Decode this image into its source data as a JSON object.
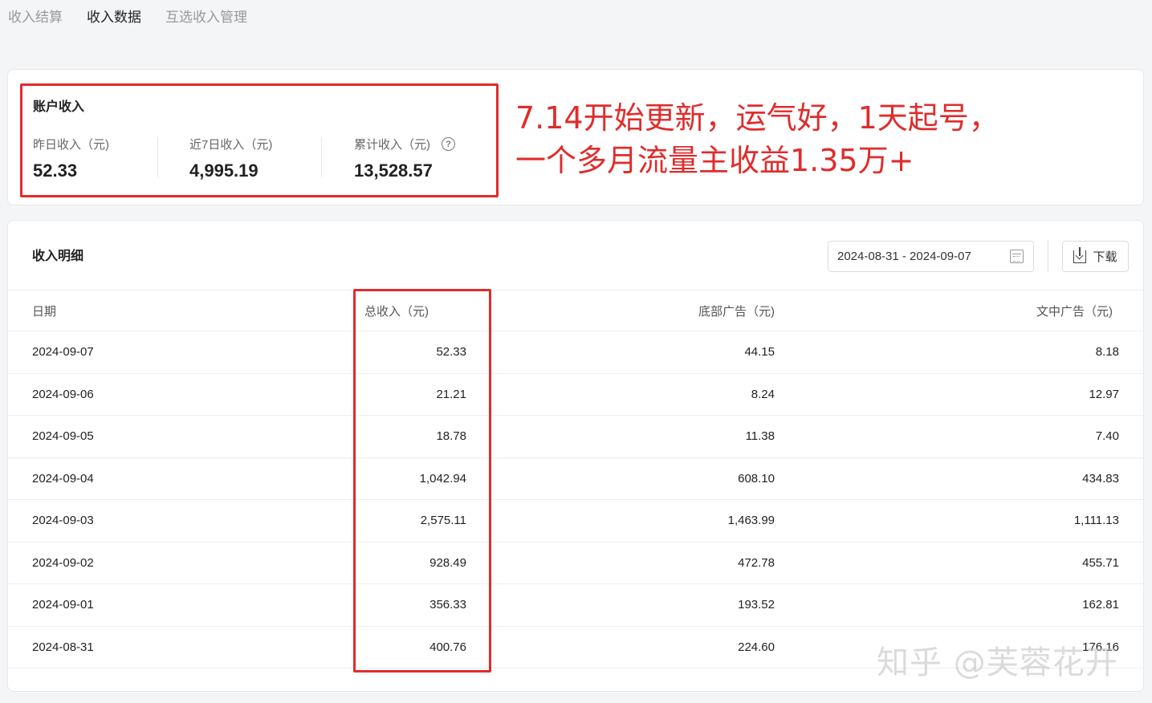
{
  "tabs": [
    {
      "label": "收入结算",
      "active": false
    },
    {
      "label": "收入数据",
      "active": true
    },
    {
      "label": "互选收入管理",
      "active": false
    }
  ],
  "account": {
    "title": "账户收入",
    "stats": [
      {
        "label": "昨日收入（元)",
        "value": "52.33"
      },
      {
        "label": "近7日收入（元)",
        "value": "4,995.19"
      },
      {
        "label": "累计收入（元)",
        "value": "13,528.57"
      }
    ],
    "help_icon": "question-circle-icon"
  },
  "annotation": {
    "line1": "7.14开始更新，运气好，1天起号，",
    "line2": "一个多月流量主收益1.35万+",
    "color": "#e02c2c"
  },
  "detail": {
    "title": "收入明细",
    "date_range": "2024-08-31 - 2024-09-07",
    "download_label": "下载",
    "columns": [
      "日期",
      "总收入（元)",
      "底部广告（元)",
      "文中广告（元)"
    ],
    "rows": [
      [
        "2024-09-07",
        "52.33",
        "44.15",
        "8.18"
      ],
      [
        "2024-09-06",
        "21.21",
        "8.24",
        "12.97"
      ],
      [
        "2024-09-05",
        "18.78",
        "11.38",
        "7.40"
      ],
      [
        "2024-09-04",
        "1,042.94",
        "608.10",
        "434.83"
      ],
      [
        "2024-09-03",
        "2,575.11",
        "1,463.99",
        "1,111.13"
      ],
      [
        "2024-09-02",
        "928.49",
        "472.78",
        "455.71"
      ],
      [
        "2024-09-01",
        "356.33",
        "193.52",
        "162.81"
      ],
      [
        "2024-08-31",
        "400.76",
        "224.60",
        "176.16"
      ]
    ]
  },
  "watermark": "知乎 @芙蓉花开"
}
